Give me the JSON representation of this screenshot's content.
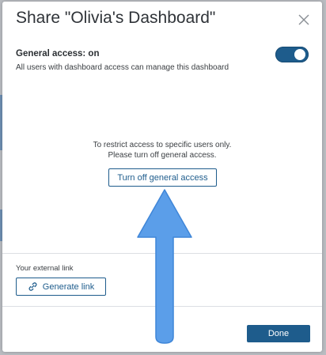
{
  "dialog": {
    "title": "Share \"Olivia's Dashboard\"",
    "close_icon": "close-icon"
  },
  "general_access": {
    "heading": "General access: on",
    "description": "All users with dashboard access can manage this dashboard",
    "toggle_state": "on"
  },
  "restrict": {
    "line1": "To restrict access to specific users only.",
    "line2": "Please turn off general access.",
    "button_label": "Turn off general access"
  },
  "external_link": {
    "label": "Your external link",
    "button_icon": "link-icon",
    "button_label": "Generate link"
  },
  "footer": {
    "done_label": "Done"
  },
  "annotation": {
    "arrow_icon": "up-arrow-icon",
    "arrow_color": "#5b9ee9"
  },
  "colors": {
    "accent": "#1e5c8c",
    "backdrop": "#b9bcc1"
  }
}
